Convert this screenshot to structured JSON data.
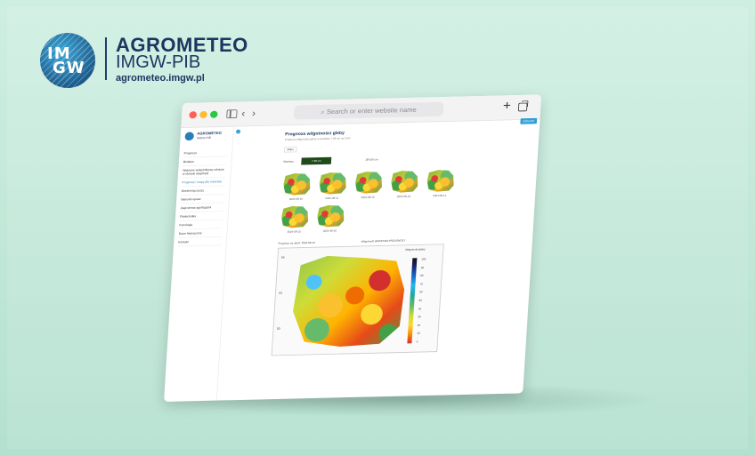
{
  "brand": {
    "logo_text_line1": "IM",
    "logo_text_line2": "GW",
    "title": "AGROMETEO",
    "subtitle": "IMGW-PIB",
    "url": "agrometeo.imgw.pl"
  },
  "browser": {
    "address_placeholder": "Search or enter website name",
    "icons": [
      "sidebar-icon",
      "back-icon",
      "forward-icon",
      "new-tab-icon",
      "tabs-overview-icon"
    ]
  },
  "site": {
    "logo_name": "AGROMETEO",
    "logo_sub": "IMGW-PIB",
    "language_button": "ENGLISH",
    "nav": [
      {
        "label": "Prognoza"
      },
      {
        "label": "Biuletyn"
      },
      {
        "label": "Wybrane wskaźnikowy rolnicze w okresie wegetacji"
      },
      {
        "label": "Prognozy i mapy dla rolnictwa"
      },
      {
        "label": "Monitoring suszy"
      },
      {
        "label": "Warunki upraw"
      },
      {
        "label": "Zagrożenia agrofagami"
      },
      {
        "label": "Fitotechnika"
      },
      {
        "label": "Fenologia"
      },
      {
        "label": "Dane historyczne"
      },
      {
        "label": "Kontakt"
      }
    ]
  },
  "content": {
    "title": "Prognoza wilgotności gleby",
    "description": "Prognoza wilgotności gleby w warstwie 7-28 cm na 5 dni",
    "chip": "Mapa",
    "filter_label": "Warstwa",
    "filter_button": "7-28 cm",
    "filter_value": "28-100 cm",
    "thumbnails": [
      {
        "date": "2024-08-10"
      },
      {
        "date": "2024-08-11"
      },
      {
        "date": "2024-08-12"
      },
      {
        "date": "2024-08-13"
      },
      {
        "date": "2024-08-14"
      },
      {
        "date": "2024-08-15"
      },
      {
        "date": "2024-08-16"
      }
    ],
    "big_map_caption": "Prognoza na dzień: 2024-08-10",
    "big_map_note": "Wilgotność WARSTWA PRZOGNOZY",
    "legend_title": "Wilgotność gleby",
    "legend_values": [
      "100",
      "90",
      "80",
      "70",
      "60",
      "50",
      "40",
      "30",
      "20",
      "10",
      "0"
    ],
    "y_axis_labels": [
      "54",
      "52",
      "50"
    ]
  }
}
